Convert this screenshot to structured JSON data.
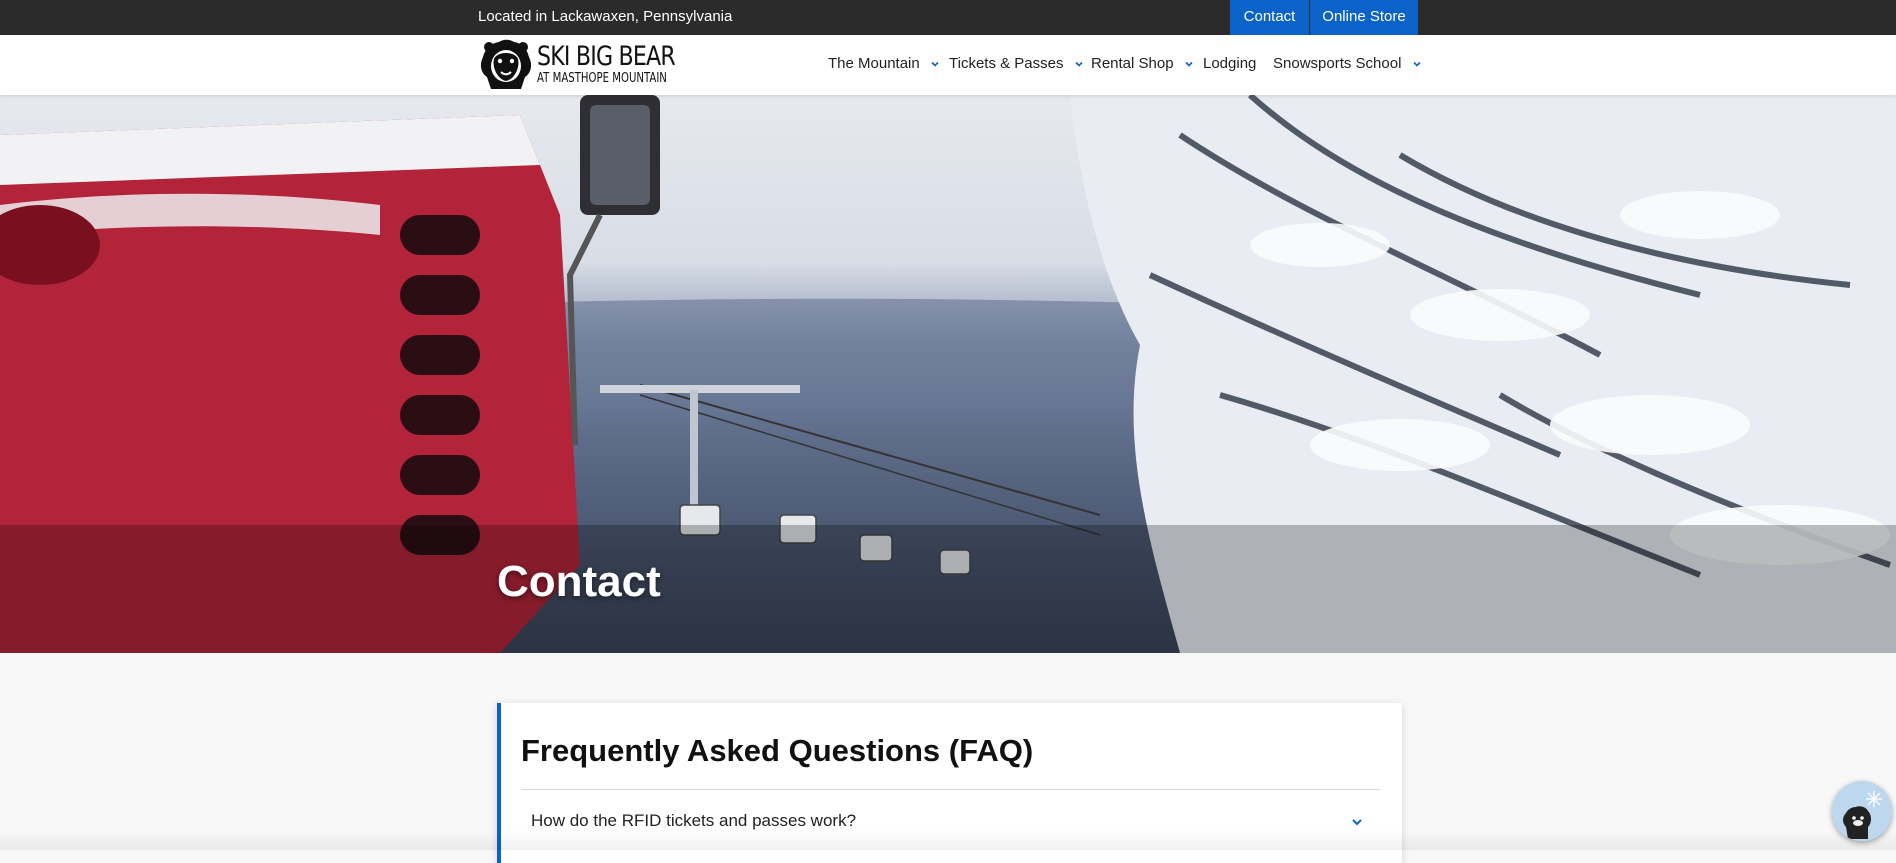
{
  "topbar": {
    "location": "Located in Lackawaxen, Pennsylvania",
    "contact_label": "Contact",
    "store_label": "Online Store",
    "accent": "#0b63c9"
  },
  "header": {
    "logo": {
      "line1": "SKI BIG BEAR",
      "line2": "AT MASTHOPE MOUNTAIN"
    },
    "nav": [
      {
        "label": "The Mountain",
        "dropdown": true
      },
      {
        "label": "Tickets & Passes",
        "dropdown": true
      },
      {
        "label": "Rental Shop",
        "dropdown": true
      },
      {
        "label": "Lodging",
        "dropdown": false
      },
      {
        "label": "Snowsports School",
        "dropdown": true
      }
    ]
  },
  "hero": {
    "title": "Contact"
  },
  "faq": {
    "title": "Frequently Asked Questions (FAQ)",
    "items": [
      {
        "question": "How do the RFID tickets and passes work?"
      }
    ]
  },
  "icons": {
    "nav_chevron": "chevron-down-icon",
    "faq_chevron": "chevron-down-icon",
    "chat": "chat-bear-icon",
    "logo": "bear-logo-icon"
  }
}
